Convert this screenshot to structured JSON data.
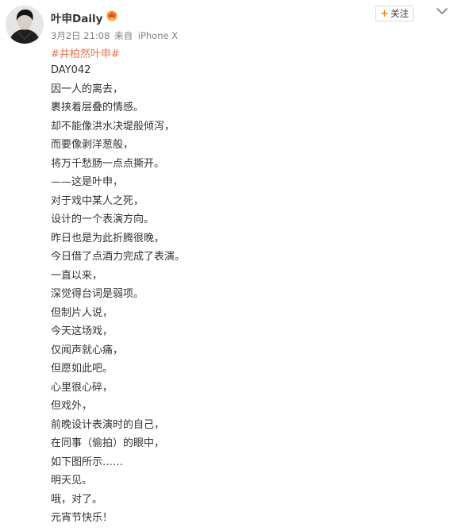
{
  "post": {
    "username": "叶申Daily",
    "date": "3月2日 21:08",
    "source_prefix": "来自",
    "source": "iPhone X",
    "follow_label": "关注",
    "hashtag": "#井柏然叶申#",
    "lines": [
      "DAY042",
      "因一人的离去，",
      "裹挟着层叠的情感。",
      "却不能像洪水决堤般倾泻，",
      "而要像剥洋葱般，",
      "将万千愁肠一点点撕开。",
      "——这是叶申，",
      "对于戏中某人之死，",
      "设计的一个表演方向。",
      "昨日也是为此折腾很晚，",
      "今日借了点酒力完成了表演。",
      "一直以来，",
      "深觉得台词是弱项。",
      "但制片人说，",
      "今天这场戏，",
      "仅闻声就心痛，",
      "但愿如此吧。",
      "心里很心碎，",
      "但戏外，",
      "前晚设计表演时的自己，",
      "在同事（偷拍）的眼中，",
      "如下图所示……",
      "明天见。",
      "哦，对了。",
      "元宵节快乐！"
    ]
  },
  "icons": {
    "avatar": "avatar-photo",
    "badge": "vip-crown-icon",
    "follow": "plus-icon",
    "menu": "chevron-down-icon"
  },
  "colors": {
    "hashtag": "#eb7350",
    "follow_plus": "#ff8200",
    "meta_text": "#808080",
    "body_text": "#333333",
    "badge": "#f5a623"
  }
}
